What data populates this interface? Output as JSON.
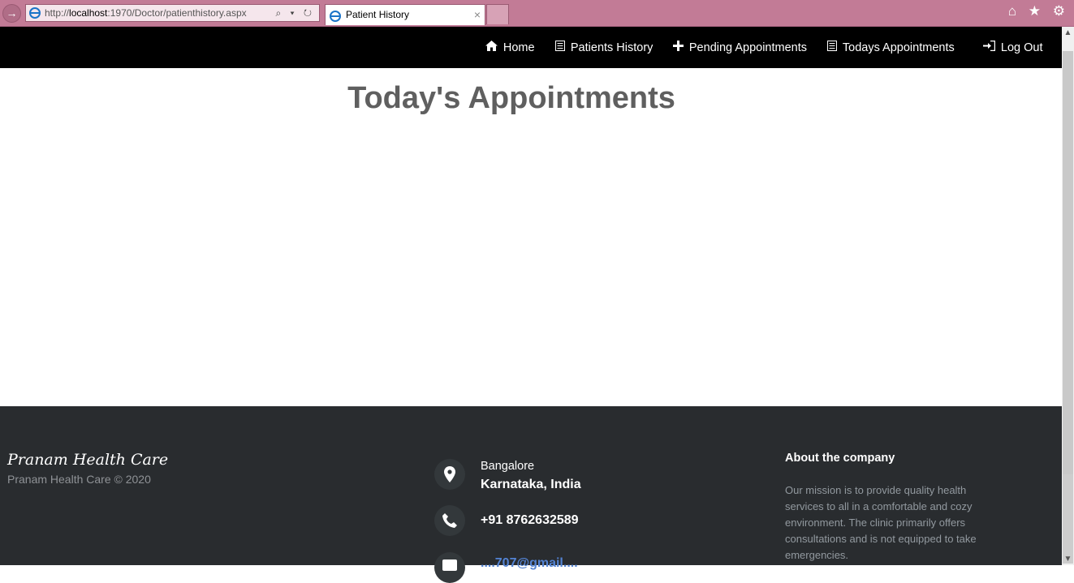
{
  "browser": {
    "url_prefix": "http://",
    "url_host": "localhost",
    "url_rest": ":1970/Doctor/patienthistory.aspx",
    "tab_title": "Patient History",
    "tab_close": "×",
    "toolbar_icons": "⌕ ▾ ↻",
    "right_icons": "⌂ ★ ⚙"
  },
  "nav": {
    "home": "Home",
    "patients_history": "Patients History",
    "pending_appointments": "Pending Appointments",
    "todays_appointments": "Todays Appointments",
    "log_out": "Log Out"
  },
  "main": {
    "title": "Today's Appointments"
  },
  "footer": {
    "brand": "Pranam Health Care",
    "copyright": "Pranam Health Care © 2020",
    "city": "Bangalore",
    "state": "Karnataka, India",
    "phone": "+91 8762632589",
    "email_partial": "....707@gmail....",
    "about_title": "About the company",
    "about_text": "Our mission is to provide quality health services to all in a comfortable and cozy environment. The clinic primarily offers consultations and is not equipped to take emergencies."
  },
  "colors": {
    "navbar_bg": "#000000",
    "footer_bg": "#292c2f",
    "title_color": "#5f5f5f",
    "chrome_bg": "#c27b96",
    "email_link": "#5383d3"
  }
}
